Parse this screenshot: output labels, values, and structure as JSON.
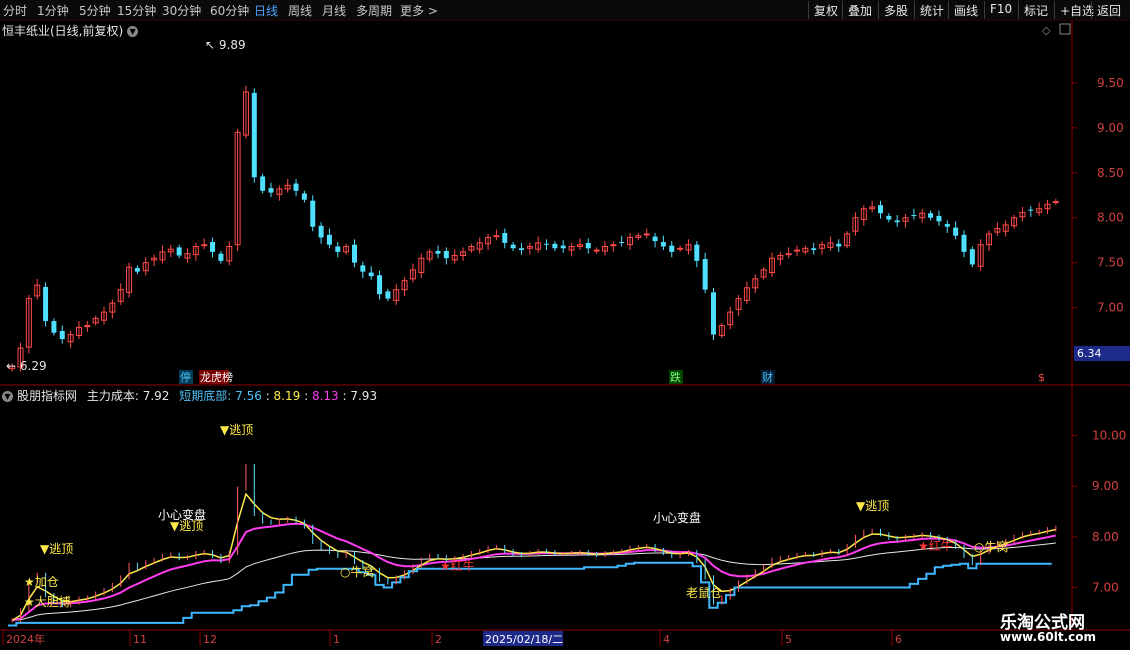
{
  "toolbar": {
    "timeframes": [
      "分时",
      "1分钟",
      "5分钟",
      "15分钟",
      "30分钟",
      "60分钟",
      "日线",
      "周线",
      "月线",
      "多周期",
      "更多 >"
    ],
    "active_timeframe": "日线",
    "buttons": [
      "复权",
      "叠加",
      "多股",
      "统计",
      "画线",
      "F10",
      "标记",
      "+自选",
      "返回"
    ]
  },
  "main_chart": {
    "title": "恒丰纸业(日线,前复权)",
    "high_label": "9.89",
    "low_label": "6.29",
    "current_price": "6.34",
    "event_markers": [
      "停",
      "龙虎榜",
      "跌",
      "财",
      "$"
    ]
  },
  "indicator": {
    "name": "股朋指标网",
    "main_cost_label": "主力成本",
    "main_cost_value": "7.92",
    "short_bottom_label": "短期底部",
    "values": [
      "7.56",
      "8.19",
      "8.13",
      "7.93"
    ],
    "signals": [
      "逃顶",
      "逃顶",
      "逃顶",
      "逃顶",
      "小心变盘",
      "小心变盘",
      "加仓",
      "大胆搏",
      "牛窝",
      "牛窝",
      "红牛",
      "红牛",
      "老鼠仓"
    ]
  },
  "watermark": {
    "site": "乐淘公式网",
    "url": "www.60lt.com"
  },
  "chart_data": [
    {
      "type": "candlestick",
      "title": "恒丰纸业(日线,前复权)",
      "x_ticks": [
        "2024年",
        "11",
        "12",
        "1",
        "2",
        "2025/02/18/二",
        "4",
        "5",
        "6"
      ],
      "y_ticks": [
        7.0,
        7.5,
        8.0,
        8.5,
        9.0,
        9.5
      ],
      "ylim": [
        6.25,
        10.0
      ],
      "marked_high": 9.89,
      "marked_low": 6.29,
      "last": 6.34,
      "series": [
        {
          "name": "close",
          "values": [
            6.35,
            6.55,
            7.1,
            7.25,
            6.85,
            6.72,
            6.65,
            6.7,
            6.78,
            6.8,
            6.88,
            6.95,
            7.05,
            7.2,
            7.45,
            7.4,
            7.5,
            7.55,
            7.62,
            7.65,
            7.58,
            7.6,
            7.68,
            7.7,
            7.62,
            7.52,
            7.68,
            8.95,
            9.4,
            8.45,
            8.3,
            8.28,
            8.32,
            8.36,
            8.3,
            8.2,
            7.9,
            7.78,
            7.7,
            7.62,
            7.68,
            7.5,
            7.4,
            7.35,
            7.15,
            7.1,
            7.2,
            7.3,
            7.42,
            7.55,
            7.62,
            7.6,
            7.55,
            7.58,
            7.62,
            7.68,
            7.72,
            7.78,
            7.8,
            7.72,
            7.66,
            7.64,
            7.68,
            7.72,
            7.7,
            7.66,
            7.66,
            7.68,
            7.7,
            7.66,
            7.64,
            7.68,
            7.7,
            7.72,
            7.78,
            7.8,
            7.82,
            7.74,
            7.68,
            7.62,
            7.66,
            7.7,
            7.52,
            7.2,
            6.7,
            6.8,
            6.95,
            7.1,
            7.22,
            7.32,
            7.42,
            7.55,
            7.58,
            7.6,
            7.64,
            7.66,
            7.64,
            7.7,
            7.72,
            7.68,
            7.82,
            8.0,
            8.1,
            8.12,
            8.05,
            7.98,
            7.95,
            8.0,
            8.02,
            8.05,
            8.0,
            7.96,
            7.9,
            7.8,
            7.62,
            7.48,
            7.7,
            7.82,
            7.88,
            7.92,
            8.0,
            8.06,
            8.08,
            8.1,
            8.15,
            8.18
          ]
        },
        {
          "name": "main_cost",
          "values": [
            7.9,
            7.92,
            7.93
          ]
        }
      ]
    },
    {
      "type": "line",
      "title": "股朋指标网",
      "y_ticks": [
        7.0,
        8.0,
        9.0,
        10.0
      ],
      "ylim": [
        6.2,
        10.8
      ],
      "series": [
        {
          "name": "主力成本",
          "values": [
            6.5,
            6.8,
            7.2,
            7.6,
            7.9,
            8.0,
            7.95,
            7.92
          ]
        },
        {
          "name": "短期底部",
          "values": [
            6.2,
            6.2,
            6.4,
            6.8,
            7.0,
            7.5,
            7.2,
            7.56
          ]
        }
      ]
    }
  ]
}
